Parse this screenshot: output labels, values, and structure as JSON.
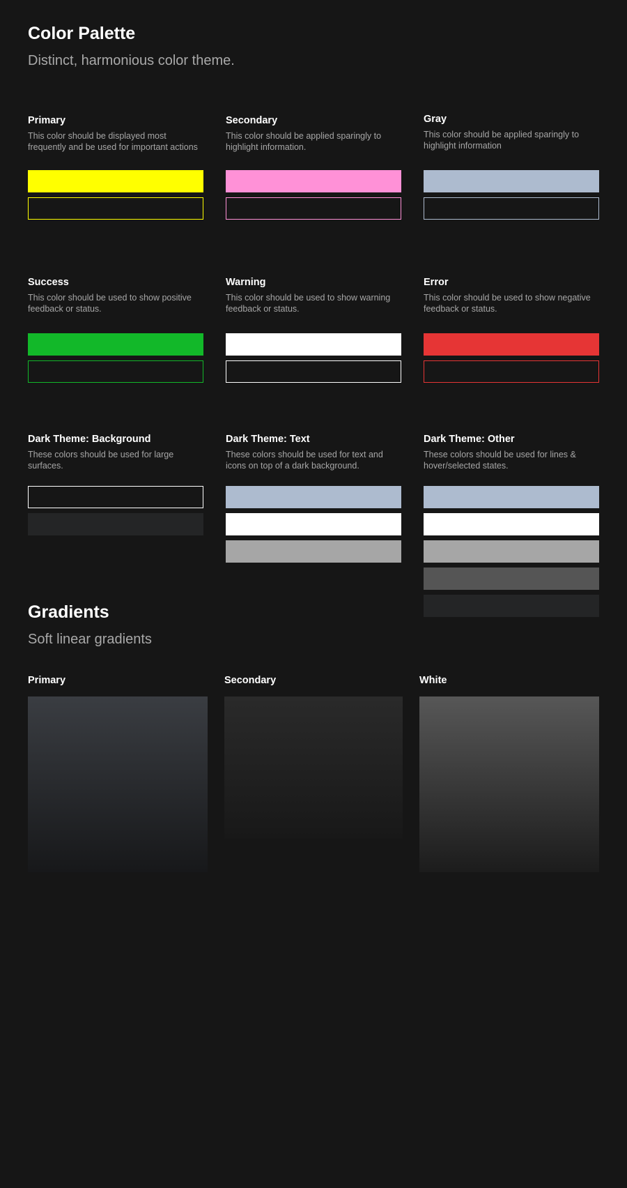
{
  "header": {
    "title": "Color Palette",
    "subtitle": "Distinct, harmonious color theme."
  },
  "palette": {
    "primary": {
      "title": "Primary",
      "description": "This color should be displayed most frequently and be used for important actions",
      "color": "#ffff00"
    },
    "secondary": {
      "title": "Secondary",
      "description": "This color should be applied sparingly to highlight information.",
      "color": "#ff91d7"
    },
    "gray": {
      "title": "Gray",
      "description": "This color should be applied sparingly to highlight information",
      "color": "#adbbcf"
    },
    "success": {
      "title": "Success",
      "description": "This color should be used to show positive feedback or status.",
      "color": "#12b829"
    },
    "warning": {
      "title": "Warning",
      "description": "This color should be used to show warning feedback or status.",
      "color": "#ffffff"
    },
    "error": {
      "title": "Error",
      "description": "This color should be used to show negative feedback or status.",
      "color": "#e63535"
    },
    "dark_background": {
      "title": "Dark Theme: Background",
      "description": "These colors should be used for large surfaces.",
      "colors": [
        "#161616",
        "#242526"
      ]
    },
    "dark_text": {
      "title": "Dark Theme: Text",
      "description": "These colors should be used for text and icons on top of a dark background.",
      "colors": [
        "#adbbcf",
        "#ffffff",
        "#a6a6a6"
      ]
    },
    "dark_other": {
      "title": "Dark Theme: Other",
      "description": "These colors should be used for lines & hover/selected states.",
      "colors": [
        "#adbbcf",
        "#ffffff",
        "#a6a6a6",
        "#555555",
        "#242526"
      ]
    }
  },
  "gradients": {
    "title": "Gradients",
    "subtitle": "Soft linear gradients",
    "primary": {
      "title": "Primary",
      "from": "#3a3d42",
      "to": "#17181a"
    },
    "secondary": {
      "title": "Secondary",
      "from": "#2a2a2a",
      "to": "#181818"
    },
    "white": {
      "title": "White",
      "from": "#575757",
      "to": "#1c1c1c"
    }
  }
}
